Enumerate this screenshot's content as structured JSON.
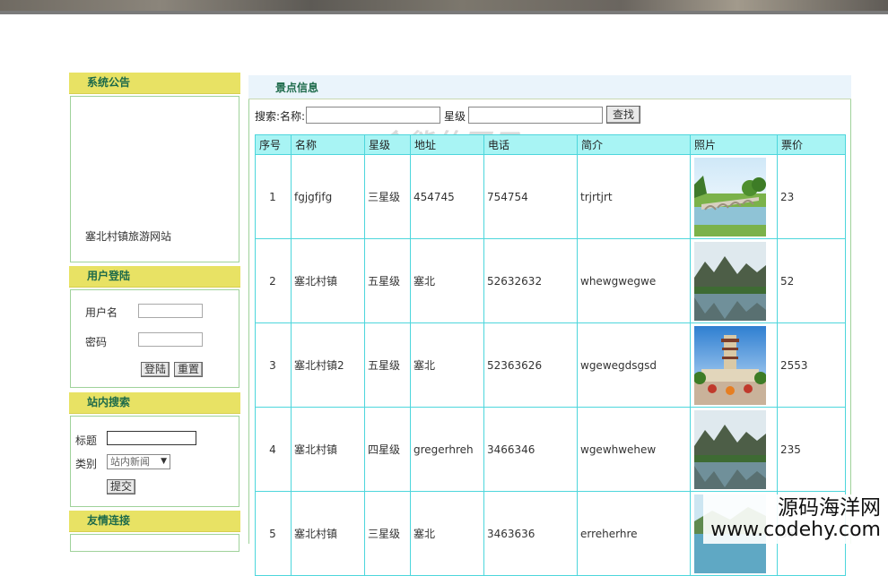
{
  "left": {
    "notice": {
      "title": "系统公告",
      "text": "塞北村镇旅游网站"
    },
    "login": {
      "title": "用户登陆",
      "username_label": "用户名",
      "password_label": "密码",
      "login_button": "登陆",
      "reset_button": "重置"
    },
    "site_search": {
      "title": "站内搜索",
      "title_label": "标题",
      "category_label": "类别",
      "category_value": "站内新闻",
      "submit_button": "提交"
    },
    "links": {
      "title": "友情连接"
    }
  },
  "main": {
    "title": "景点信息",
    "search": {
      "name_label": "搜索:名称:",
      "star_label": "星级",
      "button": "查找"
    },
    "columns": [
      "序号",
      "名称",
      "星级",
      "地址",
      "电话",
      "简介",
      "照片",
      "票价"
    ],
    "rows": [
      {
        "no": "1",
        "name": "fgjgfjfg",
        "star": "三星级",
        "address": "454745",
        "phone": "754754",
        "intro": "trjrtjrt",
        "photo": "bridge-photo",
        "price": "23"
      },
      {
        "no": "2",
        "name": "塞北村镇",
        "star": "五星级",
        "address": "塞北",
        "phone": "52632632",
        "intro": "whewgwegwe",
        "photo": "mountain-lake-photo",
        "price": "52"
      },
      {
        "no": "3",
        "name": "塞北村镇2",
        "star": "五星级",
        "address": "塞北",
        "phone": "52363626",
        "intro": "wgewegdsgsd",
        "photo": "tower-photo",
        "price": "2553"
      },
      {
        "no": "4",
        "name": "塞北村镇",
        "star": "四星级",
        "address": "gregerhreh",
        "phone": "3466346",
        "intro": "wgewhwehew",
        "photo": "mountain-lake-photo",
        "price": "235"
      },
      {
        "no": "5",
        "name": "塞北村镇",
        "star": "三星级",
        "address": "塞北",
        "phone": "3463636",
        "intro": "erreherhre",
        "photo": "lake-photo",
        "price": "36"
      }
    ]
  },
  "watermark": "金熊的豆子",
  "brand": {
    "cn": "源码海洋网",
    "en": "www.codehy.com"
  }
}
